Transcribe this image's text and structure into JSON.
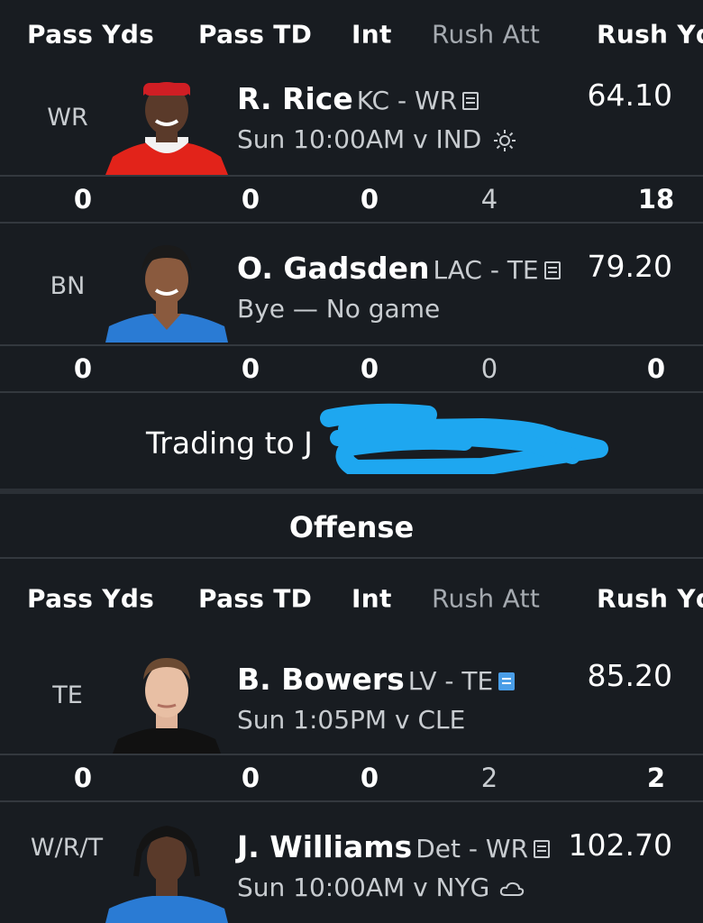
{
  "headers": [
    "Pass Yds",
    "Pass TD",
    "Int",
    "Rush Att",
    "Rush Yd"
  ],
  "roster": [
    {
      "pos": "WR",
      "name": "R. Rice",
      "team": "KC - WR",
      "sub": "Sun 10:00AM v IND",
      "weather": "sun-icon",
      "score": "64.10",
      "stats": [
        "0",
        "0",
        "0",
        "4",
        "18"
      ],
      "jersey": "#e2231a",
      "helmet": "#d01e24"
    },
    {
      "pos": "BN",
      "name": "O. Gadsden",
      "team": "LAC - TE",
      "sub": "Bye — No game",
      "weather": "",
      "score": "79.20",
      "stats": [
        "0",
        "0",
        "0",
        "0",
        "0"
      ],
      "jersey": "#2a7bd4"
    }
  ],
  "trade": {
    "label": "Trading to J"
  },
  "section": {
    "title": "Offense"
  },
  "roster2": [
    {
      "pos": "TE",
      "name": "B. Bowers",
      "team": "LV - TE",
      "sub": "Sun 1:05PM v CLE",
      "weather": "",
      "score": "85.20",
      "stats": [
        "0",
        "0",
        "0",
        "2",
        "2"
      ],
      "jersey": "#111111"
    },
    {
      "pos": "W/R/T",
      "name": "J. Williams",
      "team": "Det - WR",
      "sub": "Sun 10:00AM v NYG",
      "weather": "cloud-icon",
      "score": "102.70",
      "stats": [],
      "jersey": "#2a7bd4"
    }
  ],
  "colors": {
    "bg": "#181c21",
    "divider": "#33383e",
    "redaction": "#1ea7f0",
    "note_blue": "#4a9ee8"
  }
}
